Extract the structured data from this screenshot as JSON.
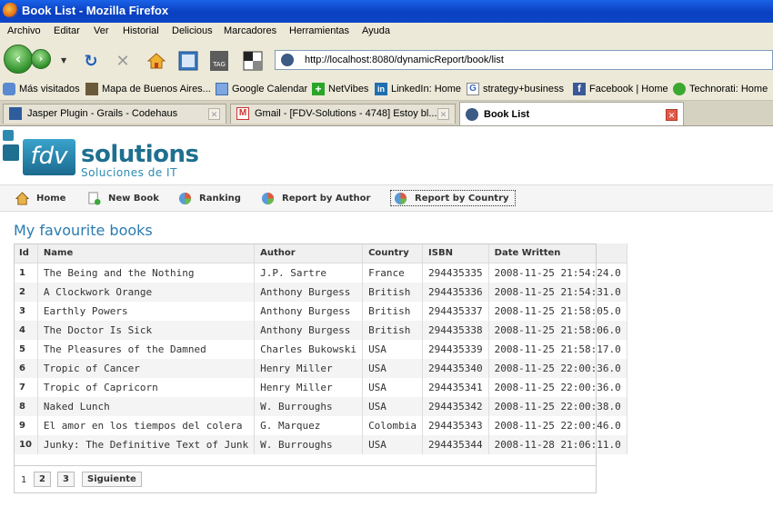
{
  "window": {
    "title": "Book List - Mozilla Firefox"
  },
  "menu": [
    "Archivo",
    "Editar",
    "Ver",
    "Historial",
    "Delicious",
    "Marcadores",
    "Herramientas",
    "Ayuda"
  ],
  "toolbar": {
    "url": "http://localhost:8080/dynamicReport/book/list",
    "icons": [
      "back-icon",
      "forward-icon",
      "reload-icon",
      "stop-icon",
      "home-icon",
      "bookmark-icon",
      "tag-icon",
      "screenshot-icon"
    ]
  },
  "bookmarks": [
    "Más visitados",
    "Mapa de Buenos Aires...",
    "Google Calendar",
    "NetVibes",
    "LinkedIn: Home",
    "strategy+business",
    "Facebook | Home",
    "Technorati: Home"
  ],
  "tabs": [
    {
      "label": "Jasper Plugin - Grails - Codehaus"
    },
    {
      "label": "Gmail - [FDV-Solutions - 4748] Estoy bl..."
    },
    {
      "label": "Book List"
    }
  ],
  "logo": {
    "mark": "fdv",
    "word": "solutions",
    "tagline": "Soluciones de IT"
  },
  "nav": [
    "Home",
    "New Book",
    "Ranking",
    "Report by Author",
    "Report by Country"
  ],
  "page_title": "My favourite books",
  "table": {
    "headers": [
      "Id",
      "Name",
      "Author",
      "Country",
      "ISBN",
      "Date Written"
    ],
    "rows": [
      [
        "1",
        "The Being and the Nothing",
        "J.P. Sartre",
        "France",
        "294435335",
        "2008-11-25 21:54:24.0"
      ],
      [
        "2",
        "A Clockwork Orange",
        "Anthony Burgess",
        "British",
        "294435336",
        "2008-11-25 21:54:31.0"
      ],
      [
        "3",
        "Earthly Powers",
        "Anthony Burgess",
        "British",
        "294435337",
        "2008-11-25 21:58:05.0"
      ],
      [
        "4",
        "The Doctor Is Sick",
        "Anthony Burgess",
        "British",
        "294435338",
        "2008-11-25 21:58:06.0"
      ],
      [
        "5",
        "The Pleasures of the Damned",
        "Charles Bukowski",
        "USA",
        "294435339",
        "2008-11-25 21:58:17.0"
      ],
      [
        "6",
        "Tropic of Cancer",
        "Henry Miller",
        "USA",
        "294435340",
        "2008-11-25 22:00:36.0"
      ],
      [
        "7",
        "Tropic of Capricorn",
        "Henry Miller",
        "USA",
        "294435341",
        "2008-11-25 22:00:36.0"
      ],
      [
        "8",
        "Naked Lunch",
        "W. Burroughs",
        "USA",
        "294435342",
        "2008-11-25 22:00:38.0"
      ],
      [
        "9",
        "El amor en los tiempos del colera",
        "G. Marquez",
        "Colombia",
        "294435343",
        "2008-11-25 22:00:46.0"
      ],
      [
        "10",
        "Junky: The Definitive Text of Junk",
        "W. Burroughs",
        "USA",
        "294435344",
        "2008-11-28 21:06:11.0"
      ]
    ]
  },
  "pagination": {
    "current": "1",
    "pages": [
      "2",
      "3"
    ],
    "next": "Siguiente"
  },
  "colors": {
    "titlebar": "#0a3fc0",
    "chrome": "#ece9d8",
    "logo": "#1e6f90",
    "page_title": "#2a7bb0"
  }
}
